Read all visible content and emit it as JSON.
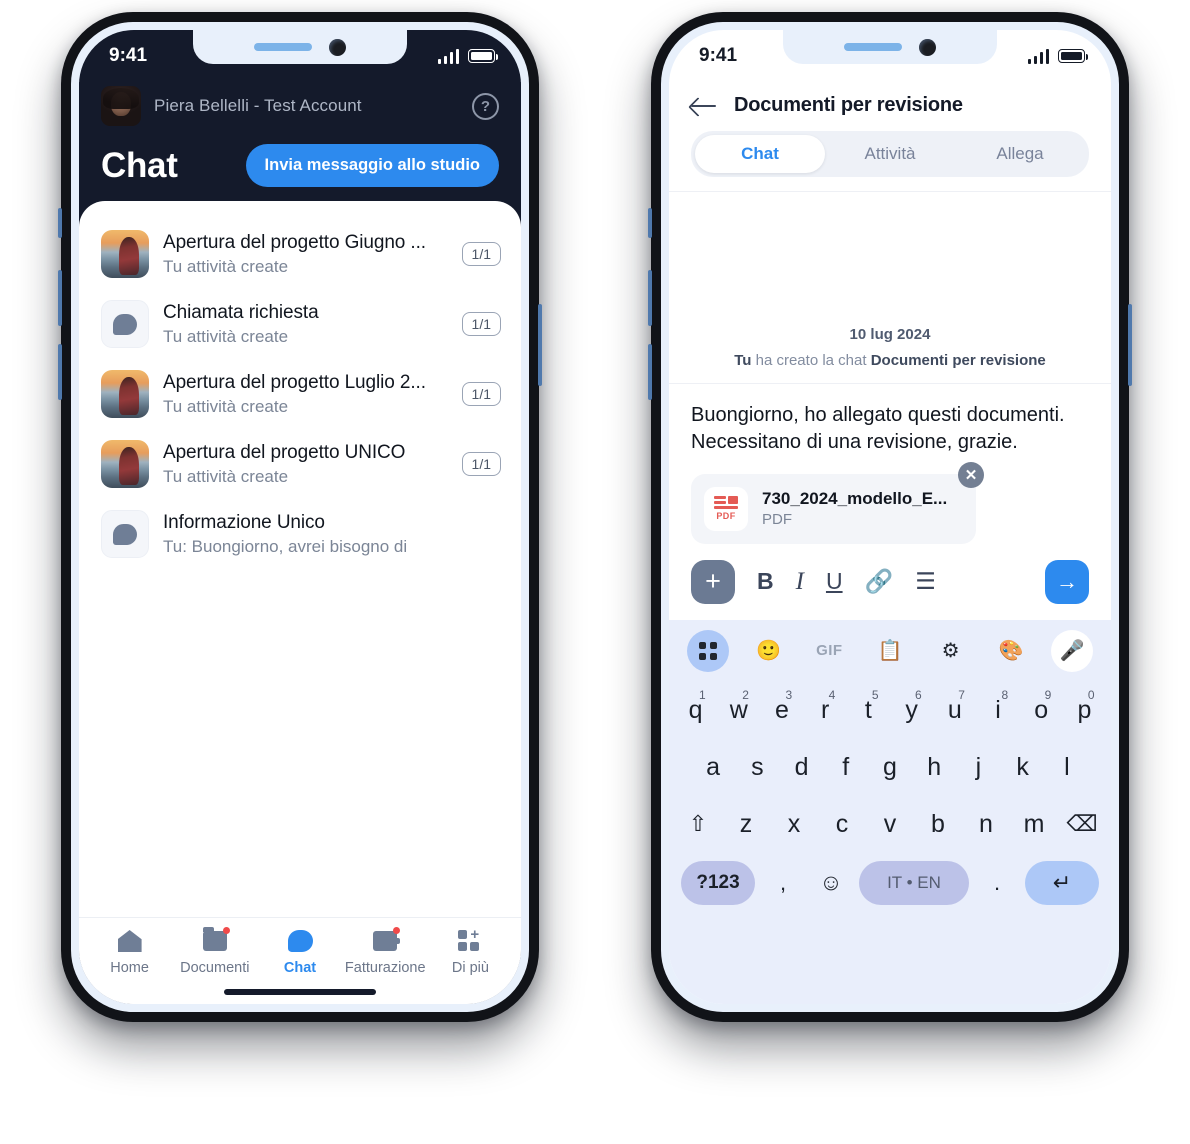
{
  "left_phone": {
    "status": {
      "time": "9:41",
      "signal_icon": "signal-bars-icon",
      "battery_icon": "battery-icon"
    },
    "header": {
      "account_name": "Piera Bellelli - Test Account",
      "help_icon": "help-circle-icon",
      "avatar": "user-avatar",
      "page_title": "Chat",
      "primary_button": "Invia messaggio allo studio"
    },
    "chat_list": [
      {
        "title": " Apertura del progetto Giugno ...",
        "subtitle": "Tu attività create",
        "badge": "1/1",
        "icon": "photo-thumbnail"
      },
      {
        "title": "Chiamata richiesta",
        "subtitle": "Tu attività create",
        "badge": "1/1",
        "icon": "chat-bubble-icon"
      },
      {
        "title": " Apertura del progetto Luglio 2...",
        "subtitle": "Tu attività create",
        "badge": "1/1",
        "icon": "photo-thumbnail"
      },
      {
        "title": " Apertura del progetto UNICO",
        "subtitle": "Tu attività create",
        "badge": "1/1",
        "icon": "photo-thumbnail"
      },
      {
        "title": "Informazione Unico",
        "subtitle": "Tu: Buongiorno, avrei bisogno di",
        "badge": "",
        "icon": "chat-bubble-icon"
      }
    ],
    "tabbar": [
      {
        "label": "Home",
        "icon": "home-icon",
        "active": false,
        "badge": false
      },
      {
        "label": "Documenti",
        "icon": "folder-icon",
        "active": false,
        "badge": true
      },
      {
        "label": "Chat",
        "icon": "chat-bubble-icon",
        "active": true,
        "badge": false
      },
      {
        "label": "Fatturazione",
        "icon": "wallet-icon",
        "active": false,
        "badge": true
      },
      {
        "label": "Di più",
        "icon": "grid-plus-icon",
        "active": false,
        "badge": false
      }
    ]
  },
  "right_phone": {
    "status": {
      "time": "9:41",
      "signal_icon": "signal-bars-icon",
      "battery_icon": "battery-icon"
    },
    "header": {
      "back_icon": "back-arrow-icon",
      "title": "Documenti per revisione"
    },
    "tabs": [
      {
        "label": "Chat",
        "active": true
      },
      {
        "label": "Attività",
        "active": false
      },
      {
        "label": "Allega",
        "active": false
      }
    ],
    "conversation": {
      "date": "10 lug 2024",
      "system_actor": "Tu",
      "system_text": " ha creato la chat ",
      "system_chat_name": "Documenti per revisione"
    },
    "composer": {
      "text": "Buongiorno, ho allegato questi documenti. Necessitano di una revisione, grazie.",
      "attachment": {
        "name": "730_2024_modello_E...",
        "type": "PDF",
        "icon": "pdf-file-icon",
        "remove_icon": "close-icon"
      },
      "toolbar": {
        "plus": "+",
        "bold": "B",
        "italic": "I",
        "underline": "U",
        "link_icon": "link-icon",
        "list_icon": "ordered-list-icon",
        "send_icon": "send-arrow-icon"
      }
    },
    "keyboard": {
      "tools": [
        "grid-icon",
        "sticker-icon",
        "GIF",
        "clipboard-icon",
        "gear-icon",
        "palette-icon",
        "mic-icon"
      ],
      "row1": [
        {
          "key": "q",
          "num": "1"
        },
        {
          "key": "w",
          "num": "2"
        },
        {
          "key": "e",
          "num": "3"
        },
        {
          "key": "r",
          "num": "4"
        },
        {
          "key": "t",
          "num": "5"
        },
        {
          "key": "y",
          "num": "6"
        },
        {
          "key": "u",
          "num": "7"
        },
        {
          "key": "i",
          "num": "8"
        },
        {
          "key": "o",
          "num": "9"
        },
        {
          "key": "p",
          "num": "0"
        }
      ],
      "row2": [
        "a",
        "s",
        "d",
        "f",
        "g",
        "h",
        "j",
        "k",
        "l"
      ],
      "row3": [
        "z",
        "x",
        "c",
        "v",
        "b",
        "n",
        "m"
      ],
      "shift_icon": "shift-icon",
      "backspace_icon": "backspace-icon",
      "numeric_key": "?123",
      "comma_key": ",",
      "emoji_icon": "emoji-icon",
      "space_label": "IT • EN",
      "period_key": ".",
      "enter_icon": "enter-icon"
    }
  },
  "colors": {
    "accent_blue": "#2d8aee",
    "dark_navy": "#141a2b",
    "bezel_blue": "#e8f0fb",
    "keyboard_bg": "#e9eefb",
    "key_pill": "#bcc2e8",
    "key_highlight": "#adc8f7",
    "pdf_red": "#e45b55",
    "badge_red": "#f04a4a",
    "muted_text": "#7b8596"
  }
}
